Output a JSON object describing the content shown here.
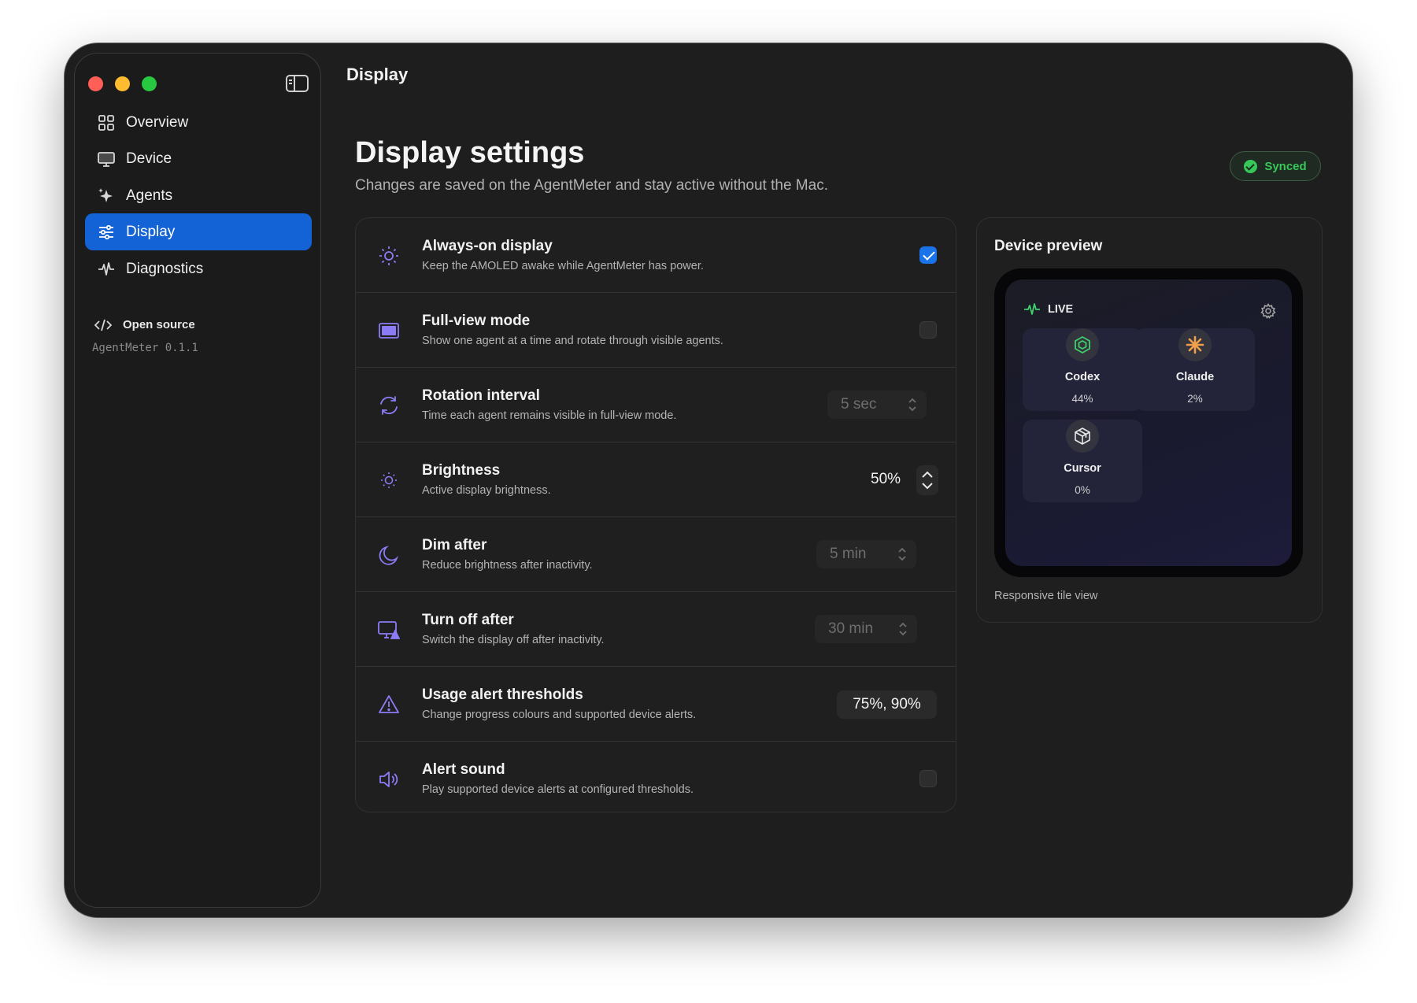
{
  "window": {
    "title": "Display"
  },
  "sidebar": {
    "items": [
      {
        "label": "Overview",
        "icon": "grid-icon"
      },
      {
        "label": "Device",
        "icon": "monitor-icon"
      },
      {
        "label": "Agents",
        "icon": "sparkle-icon"
      },
      {
        "label": "Display",
        "icon": "sliders-icon",
        "active": true
      },
      {
        "label": "Diagnostics",
        "icon": "pulse-icon"
      }
    ],
    "open_source": "Open source",
    "version": "AgentMeter 0.1.1"
  },
  "header": {
    "title": "Display settings",
    "subtitle": "Changes are saved on the AgentMeter and stay active without the Mac.",
    "status_badge": "Synced",
    "status_color": "#37c759"
  },
  "settings": {
    "rows": [
      {
        "title": "Always-on display",
        "desc": "Keep the AMOLED awake while AgentMeter has power.",
        "control": "checkbox",
        "checked": true
      },
      {
        "title": "Full-view mode",
        "desc": "Show one agent at a time and rotate through visible agents.",
        "control": "checkbox",
        "checked": false
      },
      {
        "title": "Rotation interval",
        "desc": "Time each agent remains visible in full-view mode.",
        "control": "select",
        "value": "5 sec"
      },
      {
        "title": "Brightness",
        "desc": "Active display brightness.",
        "control": "stepper",
        "value": "50%"
      },
      {
        "title": "Dim after",
        "desc": "Reduce brightness after inactivity.",
        "control": "select",
        "value": "5 min"
      },
      {
        "title": "Turn off after",
        "desc": "Switch the display off after inactivity.",
        "control": "select",
        "value": "30 min"
      },
      {
        "title": "Usage alert thresholds",
        "desc": "Change progress colours and supported device alerts.",
        "control": "field",
        "value": "75%, 90%"
      },
      {
        "title": "Alert sound",
        "desc": "Play supported device alerts at configured thresholds.",
        "control": "checkbox",
        "checked": false
      }
    ]
  },
  "preview": {
    "title": "Device preview",
    "live_label": "LIVE",
    "tiles": [
      {
        "name": "Codex",
        "percent": "44%",
        "icon": "codex-icon"
      },
      {
        "name": "Claude",
        "percent": "2%",
        "icon": "claude-icon"
      },
      {
        "name": "Cursor",
        "percent": "0%",
        "icon": "cursor-icon"
      }
    ],
    "caption": "Responsive tile view"
  },
  "colors": {
    "accent": "#1463d6",
    "icon_purple": "#8b7cf6",
    "codex_green": "#3ecf6a",
    "claude_orange": "#f0a04b"
  }
}
